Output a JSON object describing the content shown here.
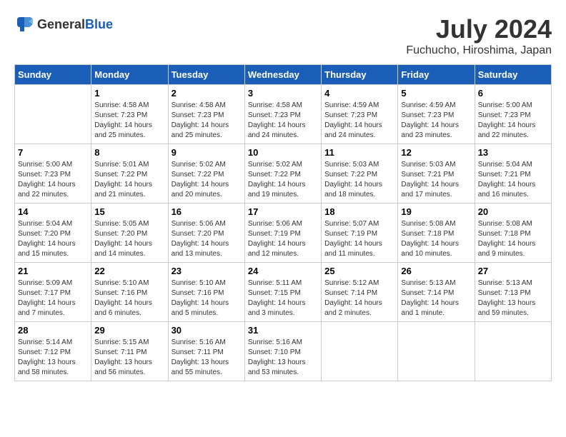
{
  "header": {
    "logo_general": "General",
    "logo_blue": "Blue",
    "month": "July 2024",
    "location": "Fuchucho, Hiroshima, Japan"
  },
  "weekdays": [
    "Sunday",
    "Monday",
    "Tuesday",
    "Wednesday",
    "Thursday",
    "Friday",
    "Saturday"
  ],
  "weeks": [
    [
      {
        "day": "",
        "info": ""
      },
      {
        "day": "1",
        "info": "Sunrise: 4:58 AM\nSunset: 7:23 PM\nDaylight: 14 hours\nand 25 minutes."
      },
      {
        "day": "2",
        "info": "Sunrise: 4:58 AM\nSunset: 7:23 PM\nDaylight: 14 hours\nand 25 minutes."
      },
      {
        "day": "3",
        "info": "Sunrise: 4:58 AM\nSunset: 7:23 PM\nDaylight: 14 hours\nand 24 minutes."
      },
      {
        "day": "4",
        "info": "Sunrise: 4:59 AM\nSunset: 7:23 PM\nDaylight: 14 hours\nand 24 minutes."
      },
      {
        "day": "5",
        "info": "Sunrise: 4:59 AM\nSunset: 7:23 PM\nDaylight: 14 hours\nand 23 minutes."
      },
      {
        "day": "6",
        "info": "Sunrise: 5:00 AM\nSunset: 7:23 PM\nDaylight: 14 hours\nand 22 minutes."
      }
    ],
    [
      {
        "day": "7",
        "info": "Sunrise: 5:00 AM\nSunset: 7:23 PM\nDaylight: 14 hours\nand 22 minutes."
      },
      {
        "day": "8",
        "info": "Sunrise: 5:01 AM\nSunset: 7:22 PM\nDaylight: 14 hours\nand 21 minutes."
      },
      {
        "day": "9",
        "info": "Sunrise: 5:02 AM\nSunset: 7:22 PM\nDaylight: 14 hours\nand 20 minutes."
      },
      {
        "day": "10",
        "info": "Sunrise: 5:02 AM\nSunset: 7:22 PM\nDaylight: 14 hours\nand 19 minutes."
      },
      {
        "day": "11",
        "info": "Sunrise: 5:03 AM\nSunset: 7:22 PM\nDaylight: 14 hours\nand 18 minutes."
      },
      {
        "day": "12",
        "info": "Sunrise: 5:03 AM\nSunset: 7:21 PM\nDaylight: 14 hours\nand 17 minutes."
      },
      {
        "day": "13",
        "info": "Sunrise: 5:04 AM\nSunset: 7:21 PM\nDaylight: 14 hours\nand 16 minutes."
      }
    ],
    [
      {
        "day": "14",
        "info": "Sunrise: 5:04 AM\nSunset: 7:20 PM\nDaylight: 14 hours\nand 15 minutes."
      },
      {
        "day": "15",
        "info": "Sunrise: 5:05 AM\nSunset: 7:20 PM\nDaylight: 14 hours\nand 14 minutes."
      },
      {
        "day": "16",
        "info": "Sunrise: 5:06 AM\nSunset: 7:20 PM\nDaylight: 14 hours\nand 13 minutes."
      },
      {
        "day": "17",
        "info": "Sunrise: 5:06 AM\nSunset: 7:19 PM\nDaylight: 14 hours\nand 12 minutes."
      },
      {
        "day": "18",
        "info": "Sunrise: 5:07 AM\nSunset: 7:19 PM\nDaylight: 14 hours\nand 11 minutes."
      },
      {
        "day": "19",
        "info": "Sunrise: 5:08 AM\nSunset: 7:18 PM\nDaylight: 14 hours\nand 10 minutes."
      },
      {
        "day": "20",
        "info": "Sunrise: 5:08 AM\nSunset: 7:18 PM\nDaylight: 14 hours\nand 9 minutes."
      }
    ],
    [
      {
        "day": "21",
        "info": "Sunrise: 5:09 AM\nSunset: 7:17 PM\nDaylight: 14 hours\nand 7 minutes."
      },
      {
        "day": "22",
        "info": "Sunrise: 5:10 AM\nSunset: 7:16 PM\nDaylight: 14 hours\nand 6 minutes."
      },
      {
        "day": "23",
        "info": "Sunrise: 5:10 AM\nSunset: 7:16 PM\nDaylight: 14 hours\nand 5 minutes."
      },
      {
        "day": "24",
        "info": "Sunrise: 5:11 AM\nSunset: 7:15 PM\nDaylight: 14 hours\nand 3 minutes."
      },
      {
        "day": "25",
        "info": "Sunrise: 5:12 AM\nSunset: 7:14 PM\nDaylight: 14 hours\nand 2 minutes."
      },
      {
        "day": "26",
        "info": "Sunrise: 5:13 AM\nSunset: 7:14 PM\nDaylight: 14 hours\nand 1 minute."
      },
      {
        "day": "27",
        "info": "Sunrise: 5:13 AM\nSunset: 7:13 PM\nDaylight: 13 hours\nand 59 minutes."
      }
    ],
    [
      {
        "day": "28",
        "info": "Sunrise: 5:14 AM\nSunset: 7:12 PM\nDaylight: 13 hours\nand 58 minutes."
      },
      {
        "day": "29",
        "info": "Sunrise: 5:15 AM\nSunset: 7:11 PM\nDaylight: 13 hours\nand 56 minutes."
      },
      {
        "day": "30",
        "info": "Sunrise: 5:16 AM\nSunset: 7:11 PM\nDaylight: 13 hours\nand 55 minutes."
      },
      {
        "day": "31",
        "info": "Sunrise: 5:16 AM\nSunset: 7:10 PM\nDaylight: 13 hours\nand 53 minutes."
      },
      {
        "day": "",
        "info": ""
      },
      {
        "day": "",
        "info": ""
      },
      {
        "day": "",
        "info": ""
      }
    ]
  ]
}
